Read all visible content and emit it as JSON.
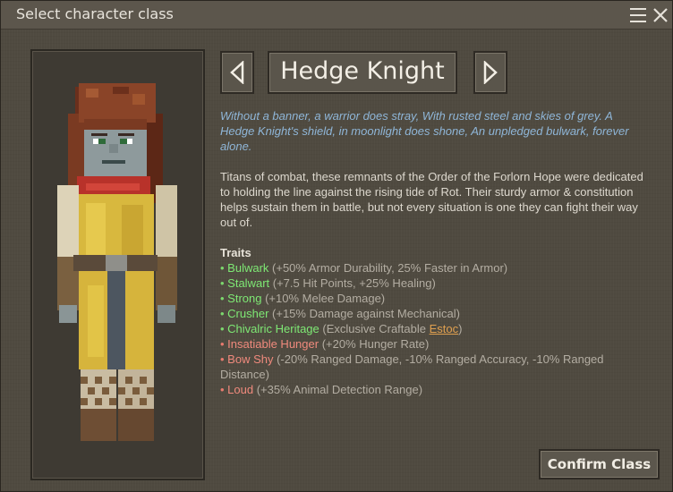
{
  "window": {
    "title": "Select character class"
  },
  "icons": {
    "menu": "hamburger-menu-icon",
    "close": "close-icon",
    "prev": "chevron-left-icon",
    "next": "chevron-right-icon"
  },
  "class_selector": {
    "name": "Hedge Knight"
  },
  "description": {
    "poem": "Without a banner, a warrior does stray, With rusted steel and skies of grey. A Hedge Knight's shield, in moonlight does shone, An unpledged bulwark, forever alone.",
    "lore": "Titans of combat, these remnants of the Order of the Forlorn Hope were dedicated to holding the line against the rising tide of Rot. Their sturdy armor & constitution helps sustain them in battle, but not every situation is one they can fight their way out of."
  },
  "traits": {
    "heading": "Traits",
    "items": [
      {
        "bullet": "•",
        "name": "Bulwark",
        "detail": " (+50% Armor Durability, 25% Faster in Armor)",
        "kind": "positive"
      },
      {
        "bullet": "•",
        "name": "Stalwart",
        "detail": " (+7.5 Hit Points, +25% Healing)",
        "kind": "positive"
      },
      {
        "bullet": "•",
        "name": "Strong",
        "detail": " (+10% Melee Damage)",
        "kind": "positive"
      },
      {
        "bullet": "•",
        "name": "Crusher",
        "detail": " (+15% Damage against Mechanical)",
        "kind": "positive"
      },
      {
        "bullet": "•",
        "name": "Chivalric Heritage",
        "detail": " (Exclusive Craftable ",
        "link": "Estoc",
        "detail_end": ")",
        "kind": "positive"
      },
      {
        "bullet": "•",
        "name": "Insatiable Hunger",
        "detail": " (+20% Hunger Rate)",
        "kind": "negative"
      },
      {
        "bullet": "•",
        "name": "Bow Shy",
        "detail": " (-20% Ranged Damage, -10% Ranged Accuracy, -10% Ranged Distance)",
        "kind": "negative"
      },
      {
        "bullet": "•",
        "name": "Loud",
        "detail": " (+35% Animal Detection Range)",
        "kind": "negative"
      }
    ]
  },
  "actions": {
    "confirm_label": "Confirm Class"
  },
  "colors": {
    "positive_trait": "#7ee874",
    "negative_trait": "#f08a7d",
    "poem": "#8fb6d8",
    "link": "#e0a050"
  }
}
